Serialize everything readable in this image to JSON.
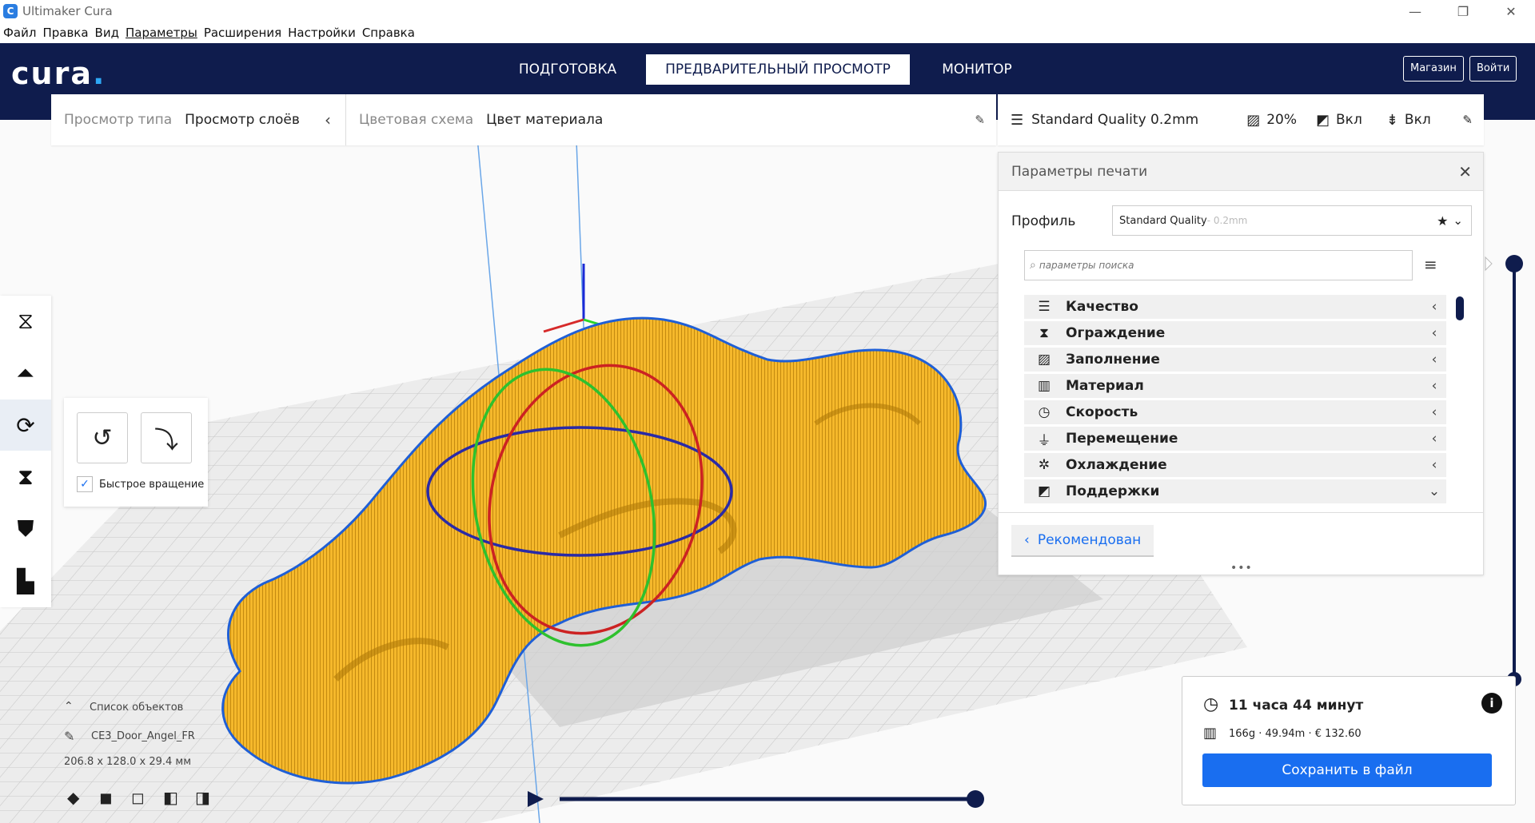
{
  "window": {
    "title": "Ultimaker Cura",
    "icon": "cura-app-icon"
  },
  "menu": [
    "Файл",
    "Правка",
    "Вид",
    "Параметры",
    "Расширения",
    "Настройки",
    "Справка"
  ],
  "header": {
    "logo": "cura",
    "tabs": [
      {
        "label": "ПОДГОТОВКА",
        "active": false
      },
      {
        "label": "ПРЕДВАРИТЕЛЬНЫЙ ПРОСМОТР",
        "active": true
      },
      {
        "label": "МОНИТОР",
        "active": false
      }
    ],
    "marketplace": "Магазин",
    "signin": "Войти"
  },
  "viewbar": {
    "view_type_label": "Просмотр типа",
    "view_type_value": "Просмотр слоёв",
    "color_scheme_label": "Цветовая схема",
    "color_scheme_value": "Цвет материала"
  },
  "settingsbar": {
    "profile": "Standard Quality 0.2mm",
    "infill": "20%",
    "support": "Вкл",
    "adhesion": "Вкл"
  },
  "panel": {
    "title": "Параметры печати",
    "profile_label": "Профиль",
    "profile_value": "Standard Quality",
    "profile_suffix": " - 0.2mm",
    "search_placeholder": "параметры поиска",
    "categories": [
      {
        "label": "Качество",
        "icon": "quality-icon",
        "expanded": false
      },
      {
        "label": "Ограждение",
        "icon": "shell-icon",
        "expanded": false
      },
      {
        "label": "Заполнение",
        "icon": "infill-icon",
        "expanded": false
      },
      {
        "label": "Материал",
        "icon": "material-icon",
        "expanded": false
      },
      {
        "label": "Скорость",
        "icon": "speed-icon",
        "expanded": false
      },
      {
        "label": "Перемещение",
        "icon": "travel-icon",
        "expanded": false
      },
      {
        "label": "Охлаждение",
        "icon": "cooling-icon",
        "expanded": false
      },
      {
        "label": "Поддержки",
        "icon": "support-icon",
        "expanded": true
      }
    ],
    "recommended": "Рекомендован"
  },
  "rotate": {
    "quick_rotate_label": "Быстрое вращение",
    "quick_rotate_checked": true
  },
  "objects": {
    "list_label": "Список объектов",
    "name": "CE3_Door_Angel_FR",
    "dimensions": "206.8 x 128.0 x 29.4 мм"
  },
  "estimate": {
    "time": "11 часа 44 минут",
    "material": "166g · 49.94m · € 132.60",
    "save": "Сохранить в файл"
  },
  "colors": {
    "header": "#0f1c4d",
    "accent": "#196ef0",
    "model": "#f5b82b"
  }
}
